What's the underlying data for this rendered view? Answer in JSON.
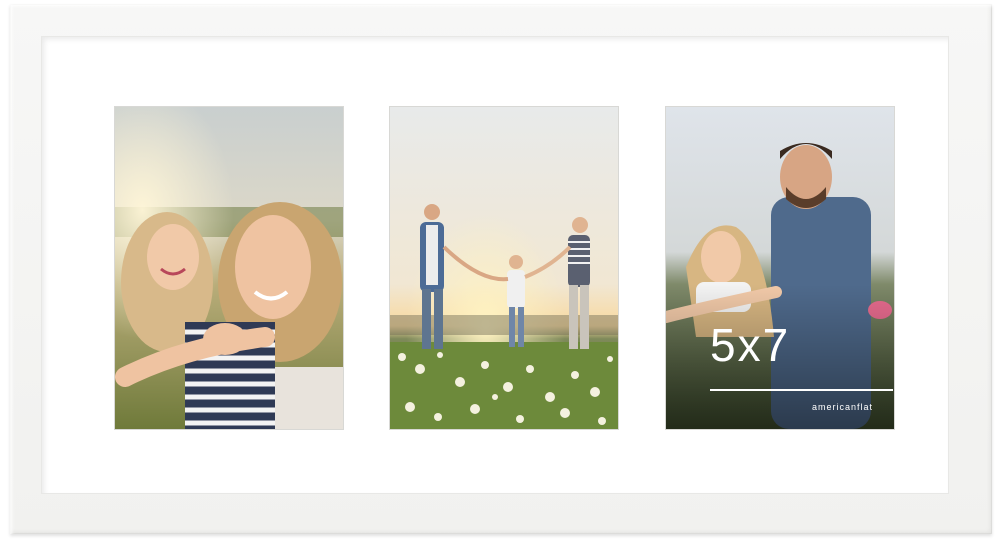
{
  "product": {
    "frame_color": "#f4f4f2",
    "mat_color": "#ffffff",
    "openings": 3
  },
  "photos": [
    {
      "subject": "mother-with-daughter-piggyback"
    },
    {
      "subject": "family-walking-in-meadow"
    },
    {
      "subject": "father-with-daughter-piggyback"
    }
  ],
  "overlay": {
    "size_label": "5x7",
    "brand": "americanflat"
  }
}
